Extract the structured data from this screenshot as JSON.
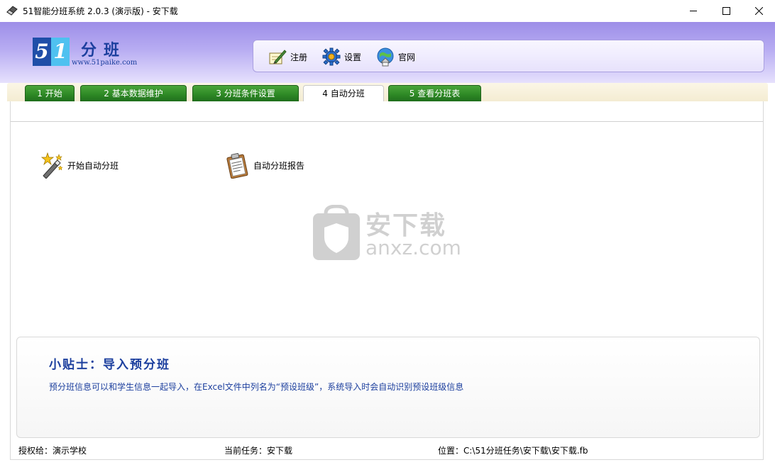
{
  "window": {
    "title": "51智能分班系统 2.0.3 (演示版) - 安下载",
    "app_icon": "pencil-eraser-icon",
    "controls": {
      "minimize": "minimize-icon",
      "maximize": "maximize-icon",
      "close": "close-icon"
    }
  },
  "header": {
    "logo": {
      "digit_five": "5",
      "digit_one": "1",
      "name": "分班",
      "url": "www.51paike.com"
    },
    "toolbar": [
      {
        "label": "注册",
        "icon": "register-pen-icon"
      },
      {
        "label": "设置",
        "icon": "gear-icon"
      },
      {
        "label": "官网",
        "icon": "globe-home-icon"
      }
    ]
  },
  "tabs": [
    {
      "label": "1 开始",
      "active": false
    },
    {
      "label": "2 基本数据维护",
      "active": false
    },
    {
      "label": "3 分班条件设置",
      "active": false
    },
    {
      "label": "4 自动分班",
      "active": true
    },
    {
      "label": "5 查看分班表",
      "active": false
    }
  ],
  "actions": {
    "start": {
      "label": "开始自动分班",
      "icon": "magic-wand-stars-icon"
    },
    "report": {
      "label": "自动分班报告",
      "icon": "clipboard-report-icon"
    }
  },
  "watermark": {
    "text": "安下载",
    "url": "anxz.com"
  },
  "tips": {
    "title": "小贴士：导入预分班",
    "body": "预分班信息可以和学生信息一起导入，在Excel文件中列名为“预设班级”，系统导入时会自动识别预设班级信息"
  },
  "status": {
    "license": "授权给：演示学校",
    "task": "当前任务：安下载",
    "location": "位置：C:\\51分班任务\\安下载\\安下载.fb"
  },
  "colors": {
    "header_top": "#9d8ee8",
    "tab_green": "#2f8a26",
    "tip_blue": "#1c3f9e"
  }
}
